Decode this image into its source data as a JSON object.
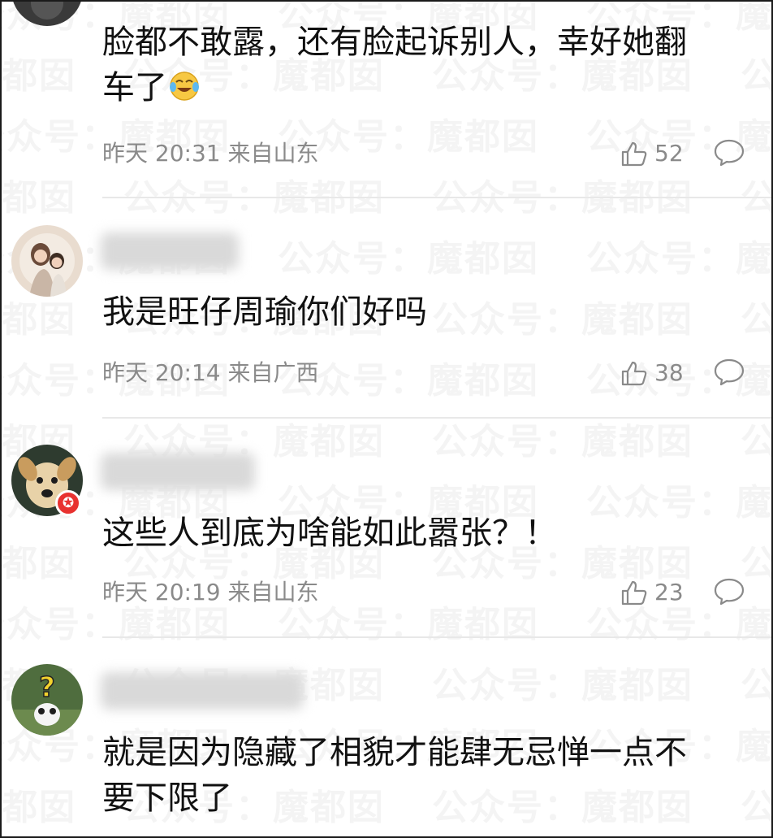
{
  "watermark": "公众号：魔都囡",
  "comments": [
    {
      "content_line1": "脸都不敢露，还有脸起诉别人，幸好她翻",
      "content_line2": "车了",
      "emoji": "laughing-crying-face",
      "time": "昨天 20:31 来自山东",
      "likes": "52"
    },
    {
      "content_line1": "我是旺仔周瑜你们好吗",
      "time": "昨天 20:14 来自广西",
      "likes": "38"
    },
    {
      "content_line1": "这些人到底为啥能如此嚣张？！",
      "time": "昨天 20:19 来自山东",
      "likes": "23",
      "badge": "✪"
    },
    {
      "content_line1": "就是因为隐藏了相貌才能肆无忌惮一点不",
      "content_line2": "要下限了"
    }
  ],
  "colors": {
    "text": "#111111",
    "meta": "#8a8a8a",
    "divider": "#e8e8e8",
    "badge": "#e8312f"
  }
}
